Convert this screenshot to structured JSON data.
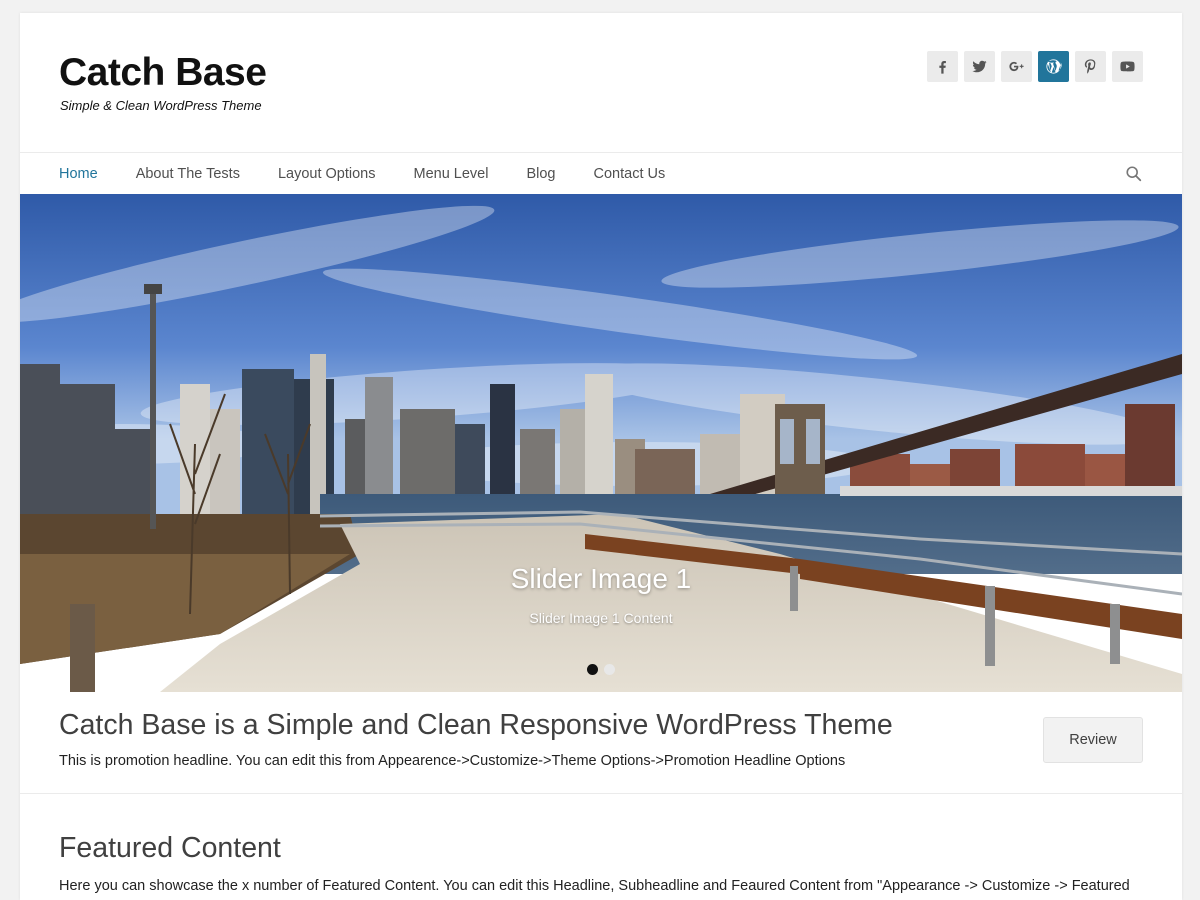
{
  "site": {
    "title": "Catch Base",
    "tagline": "Simple & Clean WordPress Theme"
  },
  "social": [
    {
      "name": "facebook-icon",
      "label": "f"
    },
    {
      "name": "twitter-icon"
    },
    {
      "name": "google-plus-icon",
      "label": "G+"
    },
    {
      "name": "wordpress-icon",
      "active": true
    },
    {
      "name": "pinterest-icon"
    },
    {
      "name": "youtube-icon"
    }
  ],
  "nav": {
    "items": [
      {
        "label": "Home",
        "current": true
      },
      {
        "label": "About The Tests"
      },
      {
        "label": "Layout Options"
      },
      {
        "label": "Menu Level"
      },
      {
        "label": "Blog"
      },
      {
        "label": "Contact Us"
      }
    ],
    "search_icon": "search-icon"
  },
  "slider": {
    "title": "Slider Image 1",
    "content": "Slider Image 1 Content",
    "slide_count": 2,
    "active_index": 0
  },
  "promo": {
    "title": "Catch Base is a Simple and Clean Responsive WordPress Theme",
    "text": "This is promotion headline. You can edit this from Appearence->Customize->Theme Options->Promotion Headline Options",
    "button_label": "Review"
  },
  "featured": {
    "title": "Featured Content",
    "text": "Here you can showcase the x number of Featured Content. You can edit this Headline, Subheadline and Feaured Content from \"Appearance -> Customize -> Featured"
  },
  "colors": {
    "accent": "#21759b",
    "background": "#f2f2f2"
  }
}
